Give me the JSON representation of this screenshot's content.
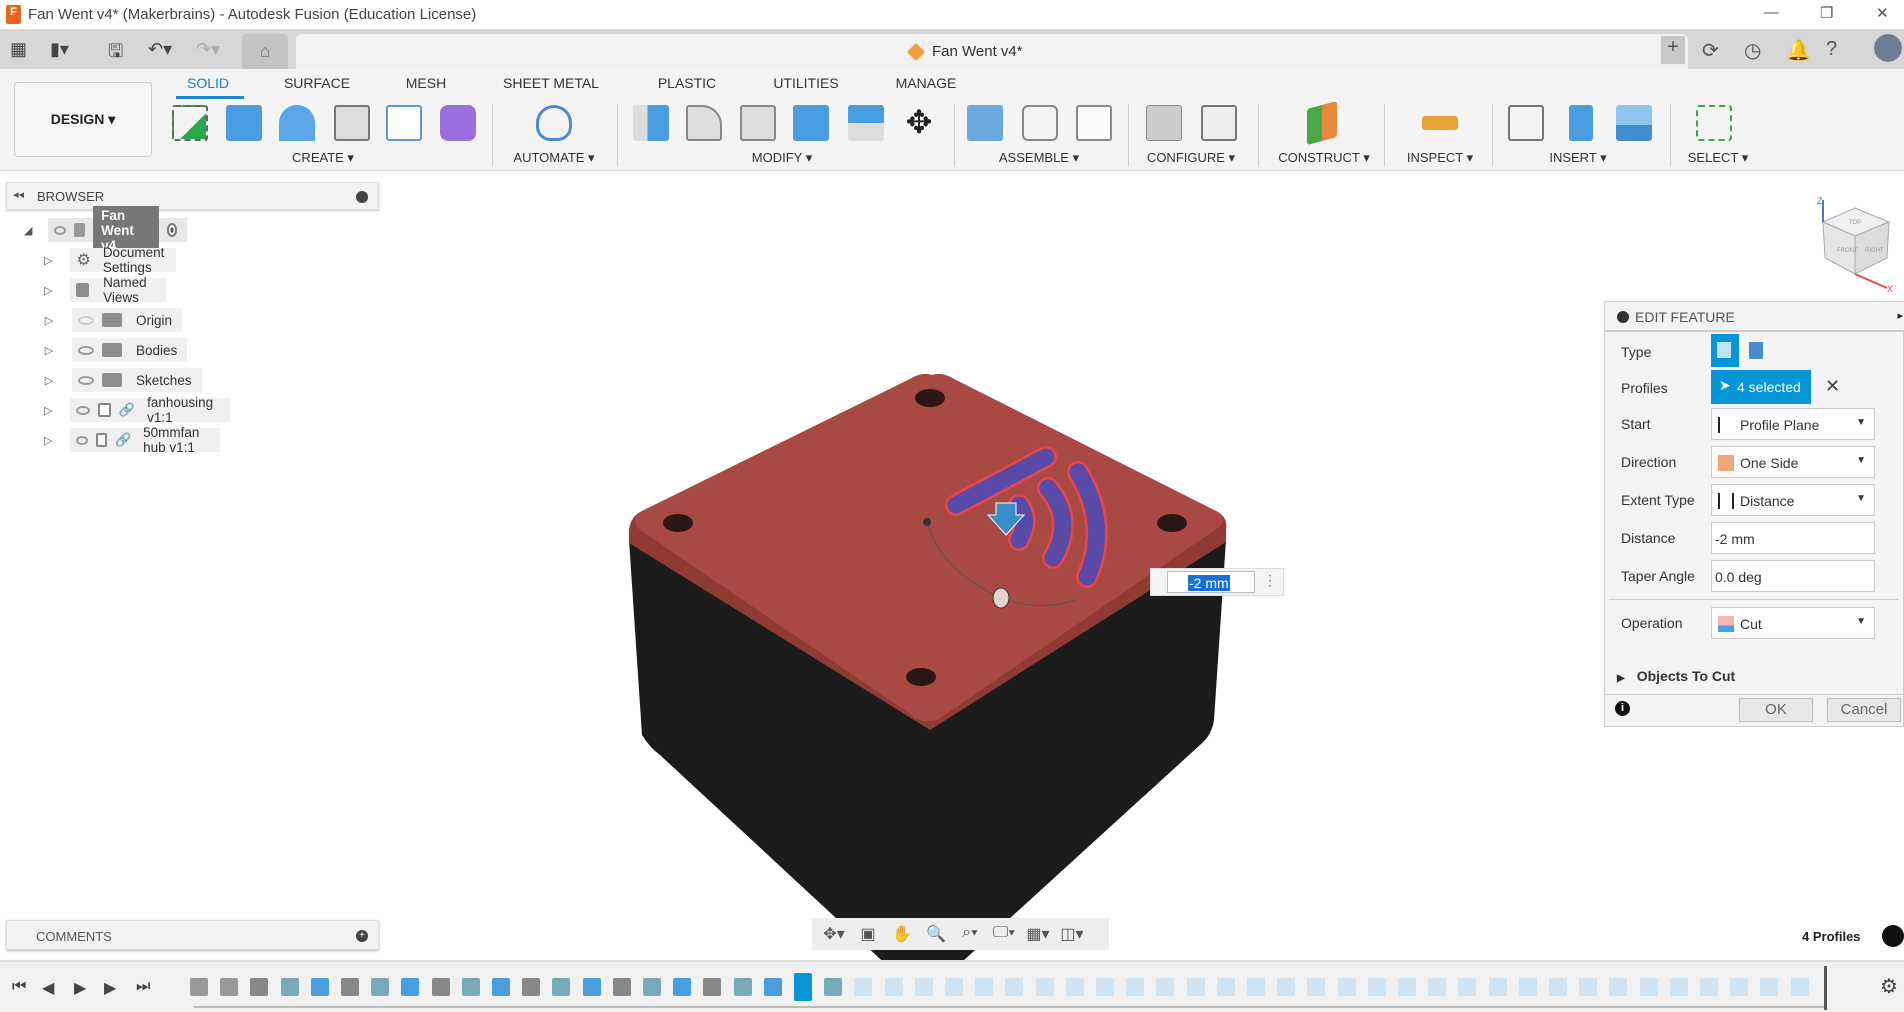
{
  "window": {
    "title": "Fan Went v4* (Makerbrains) - Autodesk Fusion (Education License)",
    "logo_letter": "F"
  },
  "document_tab": {
    "name": "Fan Went v4*"
  },
  "workspace": {
    "label": "DESIGN ▾"
  },
  "ribbon": {
    "tabs": [
      "SOLID",
      "SURFACE",
      "MESH",
      "SHEET METAL",
      "PLASTIC",
      "UTILITIES",
      "MANAGE"
    ],
    "active_tab": "SOLID",
    "groups": [
      "CREATE ▾",
      "AUTOMATE ▾",
      "MODIFY ▾",
      "ASSEMBLE ▾",
      "CONFIGURE ▾",
      "CONSTRUCT ▾",
      "INSPECT ▾",
      "INSERT ▾",
      "SELECT ▾"
    ]
  },
  "browser": {
    "title": "BROWSER",
    "root": "Fan Went v4",
    "items": [
      {
        "label": "Document Settings",
        "icon": "gear-icon"
      },
      {
        "label": "Named Views",
        "icon": "folder-icon"
      },
      {
        "label": "Origin",
        "icon": "folder-icon",
        "hidden": true
      },
      {
        "label": "Bodies",
        "icon": "folder-icon"
      },
      {
        "label": "Sketches",
        "icon": "folder-icon"
      },
      {
        "label": "fanhousing v1:1",
        "icon": "component-link-icon"
      },
      {
        "label": "50mmfan hub v1:1",
        "icon": "component-link-icon"
      }
    ]
  },
  "comments": {
    "title": "COMMENTS"
  },
  "viewport": {
    "dimension_input": "-2 mm",
    "status": "4 Profiles"
  },
  "viewcube": {
    "top": "TOP",
    "front": "FRONT",
    "right": "RIGHT",
    "z": "Z",
    "x": "X"
  },
  "edit_feature": {
    "title": "EDIT FEATURE",
    "type_label": "Type",
    "profiles_label": "Profiles",
    "profiles_value": "4 selected",
    "start_label": "Start",
    "start_value": "Profile Plane",
    "direction_label": "Direction",
    "direction_value": "One Side",
    "extent_label": "Extent Type",
    "extent_value": "Distance",
    "distance_label": "Distance",
    "distance_value": "-2 mm",
    "taper_label": "Taper Angle",
    "taper_value": "0.0 deg",
    "operation_label": "Operation",
    "operation_value": "Cut",
    "objects_label": "Objects To Cut",
    "ok": "OK",
    "cancel": "Cancel"
  },
  "colors": {
    "accent": "#0696d7",
    "body_top": "#a84a43",
    "body_side": "#1b1b1b",
    "profile": "#5a4aa8"
  }
}
